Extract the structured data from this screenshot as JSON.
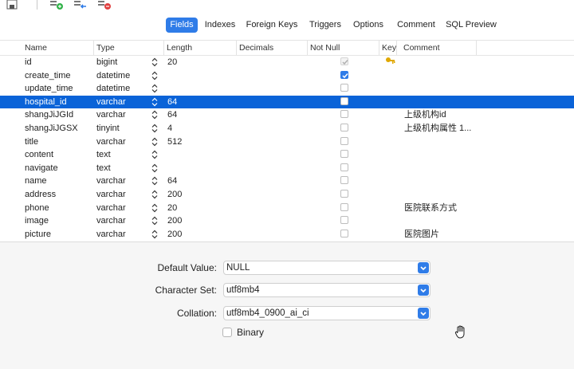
{
  "tabs": [
    "Fields",
    "Indexes",
    "Foreign Keys",
    "Triggers",
    "Options",
    "Comment",
    "SQL Preview"
  ],
  "columns": [
    "Name",
    "Type",
    "Length",
    "Decimals",
    "Not Null",
    "Key",
    "Comment"
  ],
  "rows": [
    {
      "name": "id",
      "type": "bigint",
      "length": "20",
      "not_null": "checked-disabled",
      "key": true,
      "comment": ""
    },
    {
      "name": "create_time",
      "type": "datetime",
      "length": "",
      "not_null": "checked",
      "key": false,
      "comment": ""
    },
    {
      "name": "update_time",
      "type": "datetime",
      "length": "",
      "not_null": "unchecked",
      "key": false,
      "comment": ""
    },
    {
      "name": "hospital_id",
      "type": "varchar",
      "length": "64",
      "not_null": "unchecked",
      "key": false,
      "comment": "",
      "selected": true
    },
    {
      "name": "shangJiJGId",
      "type": "varchar",
      "length": "64",
      "not_null": "unchecked",
      "key": false,
      "comment": "上级机构id"
    },
    {
      "name": "shangJiJGSX",
      "type": "tinyint",
      "length": "4",
      "not_null": "unchecked",
      "key": false,
      "comment": "上级机构属性 1..."
    },
    {
      "name": "title",
      "type": "varchar",
      "length": "512",
      "not_null": "unchecked",
      "key": false,
      "comment": ""
    },
    {
      "name": "content",
      "type": "text",
      "length": "",
      "not_null": "unchecked",
      "key": false,
      "comment": ""
    },
    {
      "name": "navigate",
      "type": "text",
      "length": "",
      "not_null": "unchecked",
      "key": false,
      "comment": ""
    },
    {
      "name": "name",
      "type": "varchar",
      "length": "64",
      "not_null": "unchecked",
      "key": false,
      "comment": ""
    },
    {
      "name": "address",
      "type": "varchar",
      "length": "200",
      "not_null": "unchecked",
      "key": false,
      "comment": ""
    },
    {
      "name": "phone",
      "type": "varchar",
      "length": "20",
      "not_null": "unchecked",
      "key": false,
      "comment": "医院联系方式"
    },
    {
      "name": "image",
      "type": "varchar",
      "length": "200",
      "not_null": "unchecked",
      "key": false,
      "comment": ""
    },
    {
      "name": "picture",
      "type": "varchar",
      "length": "200",
      "not_null": "unchecked",
      "key": false,
      "comment": "医院图片"
    }
  ],
  "properties": {
    "default_value_label": "Default Value:",
    "default_value": "NULL",
    "charset_label": "Character Set:",
    "charset": "utf8mb4",
    "collation_label": "Collation:",
    "collation": "utf8mb4_0900_ai_ci",
    "binary_label": "Binary"
  },
  "colors": {
    "accent": "#2f7ce8",
    "selection": "#0a63d8",
    "key": "#e0a800"
  }
}
